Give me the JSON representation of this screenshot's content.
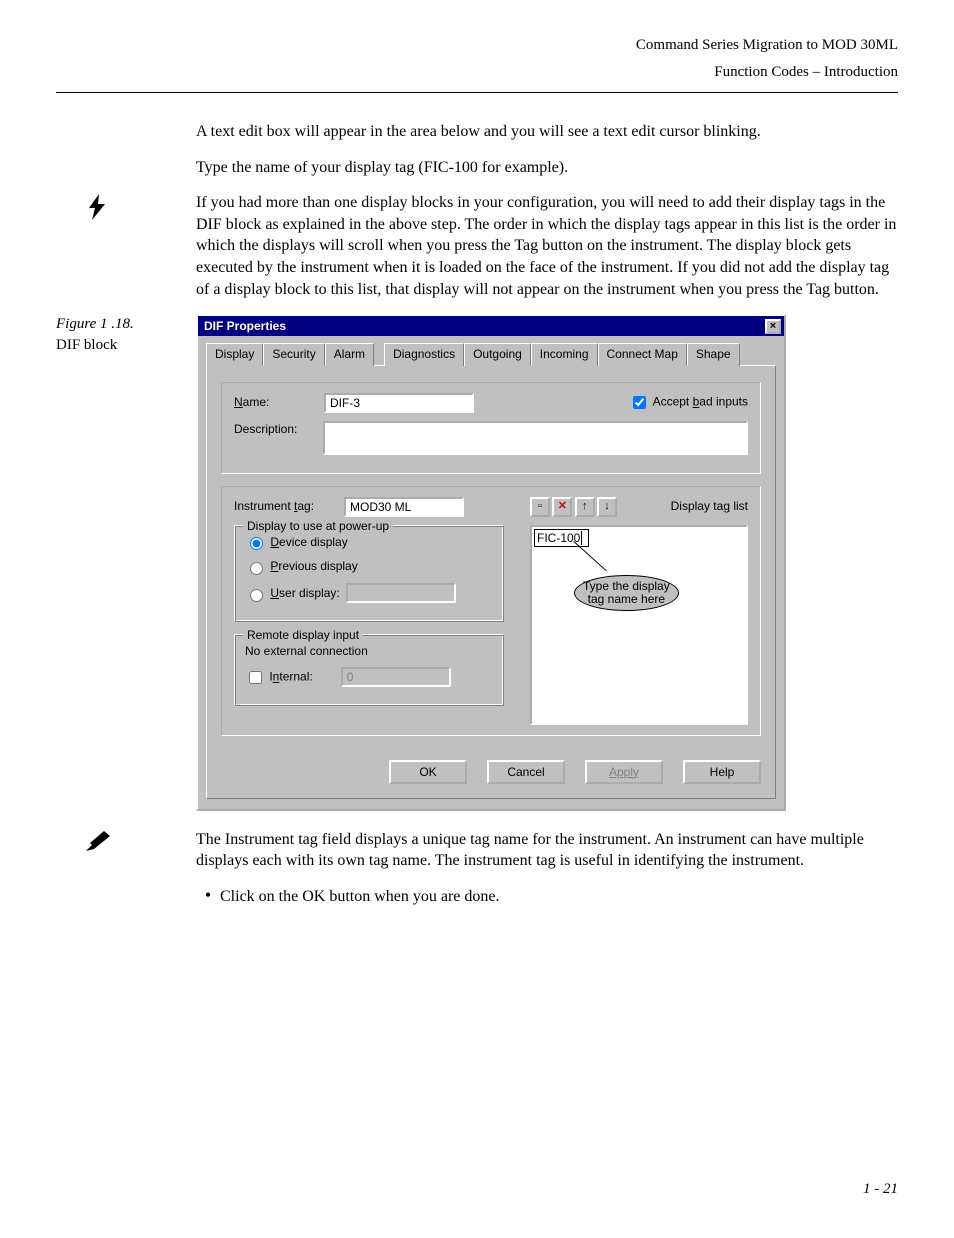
{
  "header": {
    "line1": "Command Series Migration to MOD 30ML",
    "line2": "Function Codes – Introduction"
  },
  "paragraphs": {
    "p1": "A text edit box will appear in the area below and you will see a text edit cursor blinking.",
    "p2": "Type the name of your display tag (FIC-100 for example).",
    "p3": "If you had more than one display blocks in your configuration, you will need to add their display tags in the DIF block as explained in the above step. The order in which the display tags appear in this list is the order in which the displays will scroll when you press the Tag button on the instrument. The display block gets executed by the instrument when it is loaded on the face of the instrument. If you did not add the display tag of a display block to this list, that display will not appear on the instrument when you press the Tag button.",
    "p4": "The Instrument tag field displays a unique tag name for the instrument. An instrument can have multiple displays each with its own tag name.  The instrument tag is useful in identifying the instrument.",
    "bullet1": "Click on the OK button when you are done."
  },
  "figure": {
    "label": "Figure 1 .18.",
    "caption": "DIF block"
  },
  "dialog": {
    "title": "DIF Properties",
    "tabs": [
      "Display",
      "Security",
      "Alarm",
      "Diagnostics",
      "Outgoing",
      "Incoming",
      "Connect Map",
      "Shape"
    ],
    "labels": {
      "name": "Name:",
      "description": "Description:",
      "accept_bad": "Accept bad inputs",
      "instrument_tag": "Instrument tag:",
      "display_tag_list": "Display tag list",
      "group_powerup": "Display to use at power-up",
      "radio_device": "Device display",
      "radio_previous": "Previous display",
      "radio_user": "User display:",
      "group_remote": "Remote display input",
      "no_external": "No external connection",
      "internal": "Internal:"
    },
    "values": {
      "name": "DIF-3",
      "description": "",
      "instrument_tag": "MOD30 ML",
      "user_display": "",
      "internal": "0",
      "list_item0": "FIC-100",
      "accept_bad_checked": true,
      "powerup_selected": "device"
    },
    "buttons": {
      "ok": "OK",
      "cancel": "Cancel",
      "apply": "Apply",
      "help": "Help"
    },
    "annotation": {
      "line1": "Type the display",
      "line2": "tag name here"
    }
  },
  "footer": {
    "page_number": "1 - 21"
  }
}
